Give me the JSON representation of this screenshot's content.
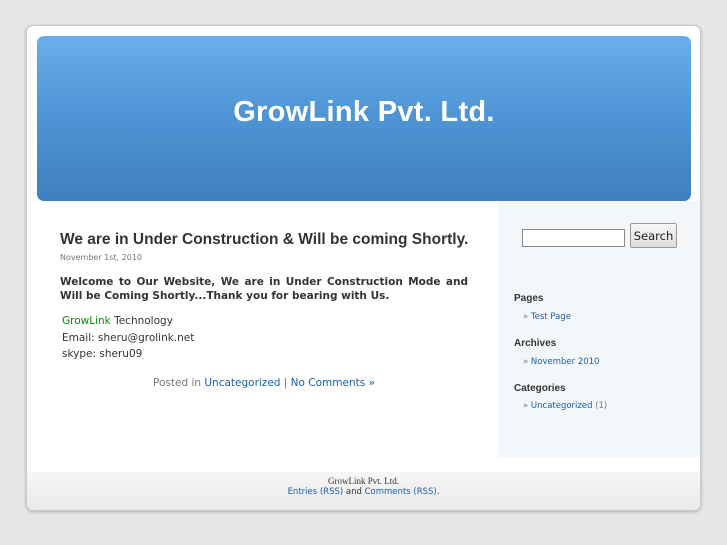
{
  "header": {
    "site_title": "GrowLink Pvt. Ltd."
  },
  "post": {
    "title": "We are in Under Construction & Will be coming Shortly.",
    "date": "November 1st, 2010",
    "intro": "Welcome to Our Website, We are in Under Construction Mode and Will be Coming Shortly...Thank you for bearing with Us.",
    "contact": {
      "company_highlight": "GrowLink",
      "company_rest": " Technology",
      "email": "Email: sheru@grolink.net",
      "skype": "skype: sheru09"
    },
    "meta": {
      "posted_in": "Posted in ",
      "category": "Uncategorized",
      "separator": " | ",
      "comments": "No Comments »"
    }
  },
  "sidebar": {
    "search": {
      "value": "",
      "button": "Search"
    },
    "pages": {
      "heading": "Pages",
      "items": [
        "Test Page"
      ]
    },
    "archives": {
      "heading": "Archives",
      "items": [
        "November 2010"
      ]
    },
    "categories": {
      "heading": "Categories",
      "item": "Uncategorized",
      "count": "(1)"
    },
    "bullet": "» "
  },
  "footer": {
    "line1": "GrowLink Pvt. Ltd.",
    "entries": "Entries (RSS)",
    "and": " and ",
    "comments": "Comments (RSS)",
    "end": "."
  }
}
